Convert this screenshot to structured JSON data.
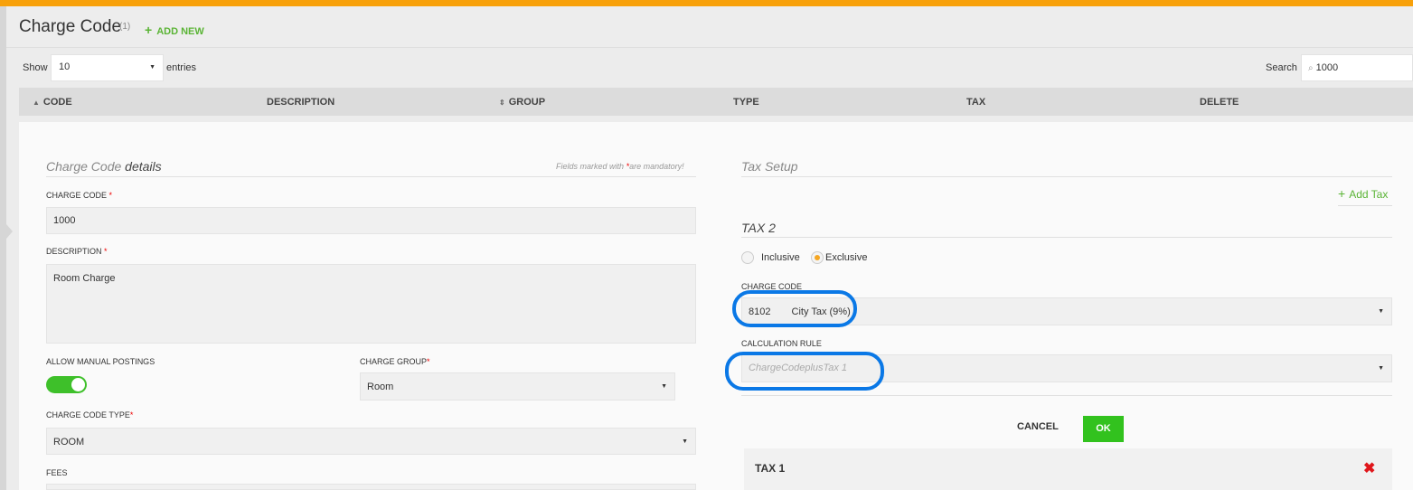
{
  "header": {
    "title": "Charge Code",
    "count": "(1)",
    "add_new": "ADD NEW"
  },
  "table_controls": {
    "show_label": "Show",
    "show_value": "10",
    "entries_label": "entries",
    "search_label": "Search",
    "search_value": "1000"
  },
  "columns": [
    "CODE",
    "DESCRIPTION",
    "GROUP",
    "TYPE",
    "TAX",
    "DELETE"
  ],
  "details": {
    "title_light": "Charge Code",
    "title_bold": "details",
    "mandatory_note": "Fields marked with",
    "mandatory_note_star": "*",
    "mandatory_note_tail": "are mandatory!",
    "charge_code_label": "CHARGE CODE",
    "charge_code_value": "1000",
    "description_label": "DESCRIPTION",
    "description_value": "Room Charge",
    "allow_manual_label": "ALLOW MANUAL POSTINGS",
    "allow_manual_on": true,
    "charge_group_label": "CHARGE GROUP",
    "charge_group_value": "Room",
    "charge_code_type_label": "CHARGE CODE TYPE",
    "charge_code_type_value": "ROOM",
    "fees_label": "FEES",
    "required_star": "*"
  },
  "tax_setup": {
    "title": "Tax Setup",
    "add_tax": "Add Tax",
    "tax2_title": "TAX 2",
    "inclusive_label": "Inclusive",
    "exclusive_label": "Exclusive",
    "selected": "Exclusive",
    "charge_code_label": "CHARGE CODE",
    "charge_code_number": "8102",
    "charge_code_name": "City Tax (9%)",
    "calc_rule_label": "CALCULATION RULE",
    "calc_rule_placeholder": "ChargeCodeplusTax 1",
    "cancel_label": "CANCEL",
    "ok_label": "OK",
    "tax1_label": "TAX 1",
    "highlight_color": "#0a78e6"
  },
  "colors": {
    "accent_top": "#f8a10a",
    "green": "#3ec02a",
    "delete_red": "#e0161b"
  }
}
